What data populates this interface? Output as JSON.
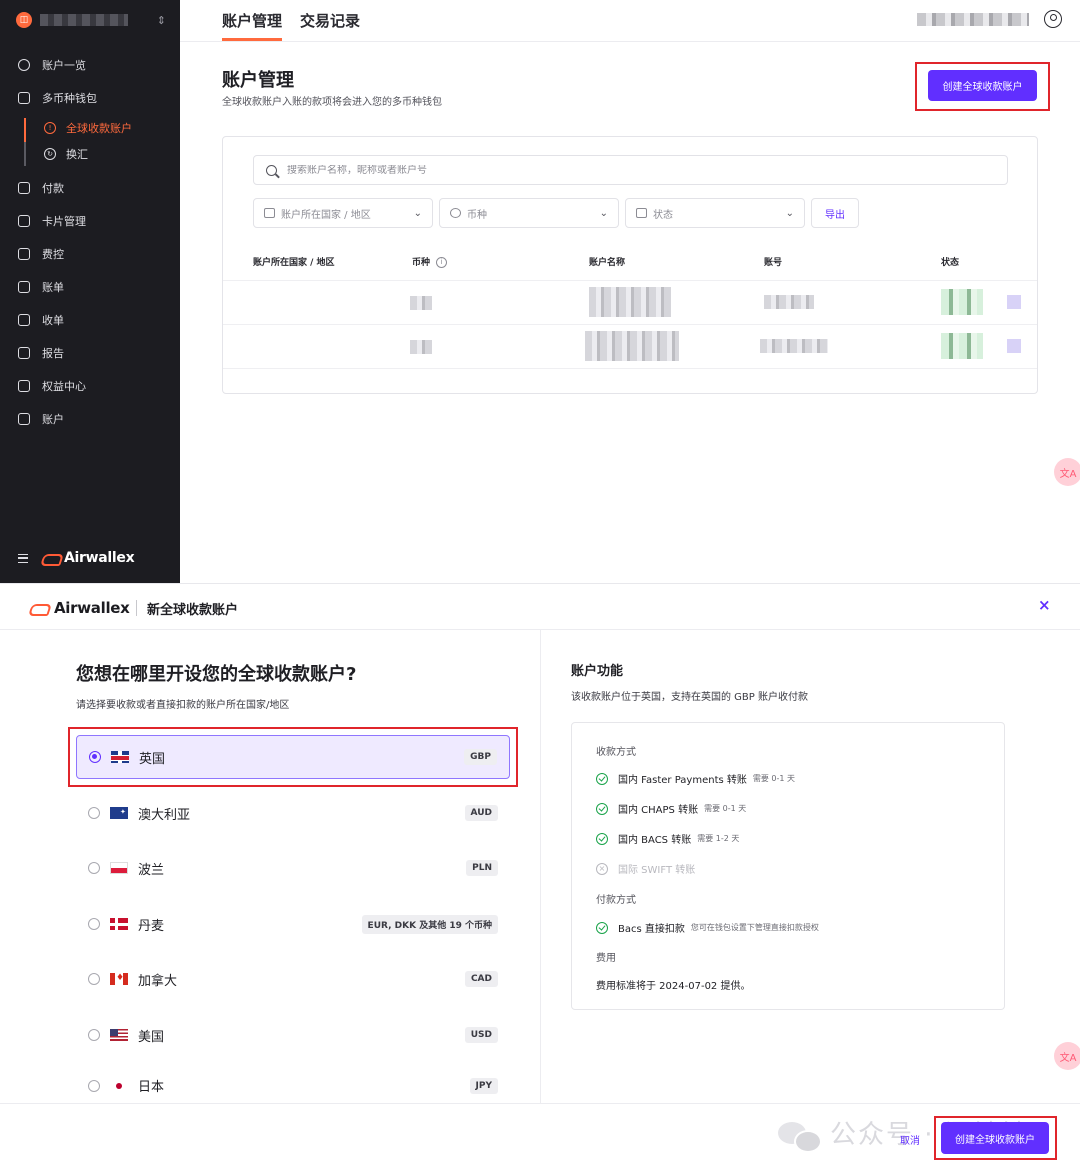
{
  "sidebar": {
    "items": [
      {
        "label": "账户一览",
        "icon": "dashboard-icon"
      },
      {
        "label": "多币种钱包",
        "icon": "wallet-icon"
      },
      {
        "label": "付款",
        "icon": "payment-icon"
      },
      {
        "label": "卡片管理",
        "icon": "card-icon"
      },
      {
        "label": "费控",
        "icon": "expense-icon"
      },
      {
        "label": "账单",
        "icon": "bill-icon"
      },
      {
        "label": "收单",
        "icon": "cart-icon"
      },
      {
        "label": "报告",
        "icon": "report-icon"
      },
      {
        "label": "权益中心",
        "icon": "trophy-icon"
      },
      {
        "label": "账户",
        "icon": "account-icon"
      }
    ],
    "sub_items": [
      {
        "label": "全球收款账户",
        "active": true
      },
      {
        "label": "换汇",
        "active": false
      }
    ],
    "brand": "Airwallex"
  },
  "topnav": {
    "tabs": [
      "账户管理",
      "交易记录"
    ]
  },
  "main": {
    "title": "账户管理",
    "subtitle": "全球收款账户入账的款项将会进入您的多币种钱包",
    "create_button": "创建全球收款账户",
    "search_placeholder": "搜索账户名称，昵称或者账户号",
    "filters": [
      "账户所在国家 / 地区",
      "币种",
      "状态"
    ],
    "export_label": "导出",
    "columns": [
      "账户所在国家 / 地区",
      "币种",
      "账户名称",
      "账号",
      "状态"
    ],
    "translate_fab": "文A"
  },
  "modal": {
    "brand": "Airwallex",
    "title": "新全球收款账户",
    "close": "×",
    "question": "您想在哪里开设您的全球收款账户?",
    "question_sub": "请选择要收款或者直接扣款的账户所在国家/地区",
    "countries": [
      {
        "name": "英国",
        "currency": "GBP",
        "flag": "uk-flag-icon",
        "selected": true
      },
      {
        "name": "澳大利亚",
        "currency": "AUD",
        "flag": "au-flag-icon",
        "selected": false
      },
      {
        "name": "波兰",
        "currency": "PLN",
        "flag": "pl-flag-icon",
        "selected": false
      },
      {
        "name": "丹麦",
        "currency": "EUR, DKK 及其他 19 个币种",
        "flag": "dk-flag-icon",
        "selected": false
      },
      {
        "name": "加拿大",
        "currency": "CAD",
        "flag": "ca-flag-icon",
        "selected": false
      },
      {
        "name": "美国",
        "currency": "USD",
        "flag": "us-flag-icon",
        "selected": false
      },
      {
        "name": "日本",
        "currency": "JPY",
        "flag": "jp-flag-icon",
        "selected": false
      }
    ],
    "features_title": "账户功能",
    "features_sub": "该收款账户位于英国，支持在英国的 GBP 账户收付款",
    "receive_heading": "收款方式",
    "receive_methods": [
      {
        "label": "国内 Faster Payments 转账",
        "note": "需要 0-1 天",
        "enabled": true
      },
      {
        "label": "国内 CHAPS 转账",
        "note": "需要 0-1 天",
        "enabled": true
      },
      {
        "label": "国内 BACS 转账",
        "note": "需要 1-2 天",
        "enabled": true
      },
      {
        "label": "国际 SWIFT 转账",
        "note": "",
        "enabled": false
      }
    ],
    "pay_heading": "付款方式",
    "pay_methods": [
      {
        "label": "Bacs 直接扣款",
        "note": "您可在钱包设置下管理直接扣款授权",
        "enabled": true
      }
    ],
    "fee_heading": "费用",
    "fee_text": "费用标准将于 2024-07-02 提供。",
    "cancel_label": "取消",
    "submit_label": "创建全球收款账户",
    "watermark": "公众号 · 漂铁铁"
  },
  "colors": {
    "accent": "#612fff",
    "brand_orange": "#ff6a3d",
    "highlight_red": "#e0252b",
    "sidebar_bg": "#1c1c21"
  }
}
